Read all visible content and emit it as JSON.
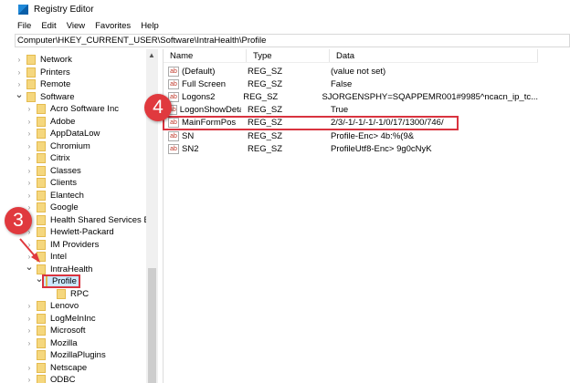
{
  "window": {
    "title": "Registry Editor"
  },
  "menu": [
    "File",
    "Edit",
    "View",
    "Favorites",
    "Help"
  ],
  "address": "Computer\\HKEY_CURRENT_USER\\Software\\IntraHealth\\Profile",
  "tree": [
    {
      "label": "Network",
      "level": 0,
      "state": "collapsed"
    },
    {
      "label": "Printers",
      "level": 0,
      "state": "collapsed"
    },
    {
      "label": "Remote",
      "level": 0,
      "state": "collapsed"
    },
    {
      "label": "Software",
      "level": 0,
      "state": "expanded"
    },
    {
      "label": "Acro Software Inc",
      "level": 1,
      "state": "collapsed"
    },
    {
      "label": "Adobe",
      "level": 1,
      "state": "collapsed"
    },
    {
      "label": "AppDataLow",
      "level": 1,
      "state": "collapsed"
    },
    {
      "label": "Chromium",
      "level": 1,
      "state": "collapsed"
    },
    {
      "label": "Citrix",
      "level": 1,
      "state": "collapsed"
    },
    {
      "label": "Classes",
      "level": 1,
      "state": "collapsed"
    },
    {
      "label": "Clients",
      "level": 1,
      "state": "collapsed"
    },
    {
      "label": "Elantech",
      "level": 1,
      "state": "collapsed"
    },
    {
      "label": "Google",
      "level": 1,
      "state": "collapsed"
    },
    {
      "label": "Health Shared Services BC",
      "level": 1,
      "state": "collapsed"
    },
    {
      "label": "Hewlett-Packard",
      "level": 1,
      "state": "collapsed"
    },
    {
      "label": "IM Providers",
      "level": 1,
      "state": "collapsed"
    },
    {
      "label": "Intel",
      "level": 1,
      "state": "collapsed"
    },
    {
      "label": "IntraHealth",
      "level": 1,
      "state": "expanded"
    },
    {
      "label": "Profile",
      "level": 2,
      "state": "expanded",
      "selected": true
    },
    {
      "label": "RPC",
      "level": 3,
      "state": "leaf"
    },
    {
      "label": "Lenovo",
      "level": 1,
      "state": "collapsed"
    },
    {
      "label": "LogMeInInc",
      "level": 1,
      "state": "collapsed"
    },
    {
      "label": "Microsoft",
      "level": 1,
      "state": "collapsed"
    },
    {
      "label": "Mozilla",
      "level": 1,
      "state": "collapsed"
    },
    {
      "label": "MozillaPlugins",
      "level": 1,
      "state": "leaf"
    },
    {
      "label": "Netscape",
      "level": 1,
      "state": "collapsed"
    },
    {
      "label": "ODBC",
      "level": 1,
      "state": "collapsed"
    }
  ],
  "columns": [
    "Name",
    "Type",
    "Data"
  ],
  "values": [
    {
      "name": "(Default)",
      "type": "REG_SZ",
      "data": "(value not set)"
    },
    {
      "name": "Full Screen",
      "type": "REG_SZ",
      "data": "False"
    },
    {
      "name": "Logons2",
      "type": "REG_SZ",
      "data": "SJORGENSPHY=SQAPPEMR001#9985^ncacn_ip_tc..."
    },
    {
      "name": "LogonShowDeta...",
      "type": "REG_SZ",
      "data": "True"
    },
    {
      "name": "MainFormPos",
      "type": "REG_SZ",
      "data": "2/3/-1/-1/-1/-1/0/17/1300/746/",
      "highlighted": true
    },
    {
      "name": "SN",
      "type": "REG_SZ",
      "data": "Profile-Enc> 4b:%(9&"
    },
    {
      "name": "SN2",
      "type": "REG_SZ",
      "data": "ProfileUtf8-Enc> 9g0cNyK"
    }
  ],
  "value_icon": "ab",
  "callouts": [
    "3",
    "4"
  ],
  "colors": {
    "callout": "#e0393e",
    "selection": "#cce8ff",
    "folder": "#f5d77e"
  }
}
